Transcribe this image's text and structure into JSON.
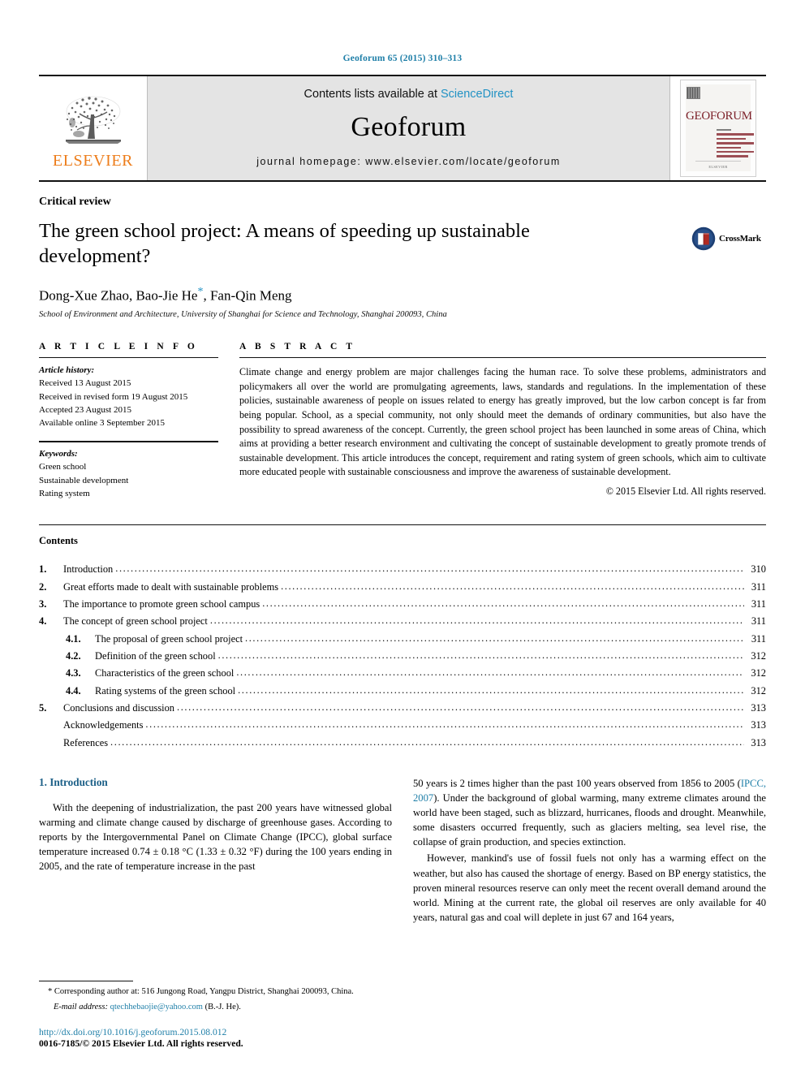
{
  "running_head": "Geoforum 65 (2015) 310–313",
  "masthead": {
    "publisher_name": "ELSEVIER",
    "contents_prefix": "Contents lists available at ",
    "sciencedirect": "ScienceDirect",
    "journal_name": "Geoforum",
    "homepage": "journal homepage: www.elsevier.com/locate/geoforum",
    "cover_title": "GEOFORUM",
    "cover_publisher": "ELSEVIER"
  },
  "article": {
    "doctype": "Critical review",
    "title": "The green school project: A means of speeding up sustainable development?",
    "authors": "Dong-Xue Zhao, Bao-Jie He",
    "authors_tail": ", Fan-Qin Meng",
    "corresponding_marker": "*",
    "affiliation": "School of Environment and Architecture, University of Shanghai for Science and Technology, Shanghai 200093, China",
    "crossmark_label": "CrossMark"
  },
  "info": {
    "heading": "A R T I C L E  I N F O",
    "history_label": "Article history:",
    "history": [
      "Received 13 August 2015",
      "Received in revised form 19 August 2015",
      "Accepted 23 August 2015",
      "Available online 3 September 2015"
    ],
    "keywords_label": "Keywords:",
    "keywords": [
      "Green school",
      "Sustainable development",
      "Rating system"
    ]
  },
  "abstract": {
    "heading": "A B S T R A C T",
    "text": "Climate change and energy problem are major challenges facing the human race. To solve these problems, administrators and policymakers all over the world are promulgating agreements, laws, standards and regulations. In the implementation of these policies, sustainable awareness of people on issues related to energy has greatly improved, but the low carbon concept is far from being popular. School, as a special community, not only should meet the demands of ordinary communities, but also have the possibility to spread awareness of the concept. Currently, the green school project has been launched in some areas of China, which aims at providing a better research environment and cultivating the concept of sustainable development to greatly promote trends of sustainable development. This article introduces the concept, requirement and rating system of green schools, which aim to cultivate more educated people with sustainable consciousness and improve the awareness of sustainable development.",
    "copyright": "© 2015 Elsevier Ltd. All rights reserved."
  },
  "contents": {
    "label": "Contents",
    "entries": [
      {
        "num": "1.",
        "sub": "",
        "label": "Introduction",
        "page": "310",
        "level": 1
      },
      {
        "num": "2.",
        "sub": "",
        "label": "Great efforts made to dealt with sustainable problems",
        "page": "311",
        "level": 1
      },
      {
        "num": "3.",
        "sub": "",
        "label": "The importance to promote green school campus",
        "page": "311",
        "level": 1
      },
      {
        "num": "4.",
        "sub": "",
        "label": "The concept of green school project",
        "page": "311",
        "level": 1
      },
      {
        "num": "",
        "sub": "4.1.",
        "label": "The proposal of green school project",
        "page": "311",
        "level": 2
      },
      {
        "num": "",
        "sub": "4.2.",
        "label": "Definition of the green school",
        "page": "312",
        "level": 2
      },
      {
        "num": "",
        "sub": "4.3.",
        "label": "Characteristics of the green school",
        "page": "312",
        "level": 2
      },
      {
        "num": "",
        "sub": "4.4.",
        "label": "Rating systems of the green school",
        "page": "312",
        "level": 2
      },
      {
        "num": "5.",
        "sub": "",
        "label": "Conclusions and discussion",
        "page": "313",
        "level": 1
      },
      {
        "num": "",
        "sub": "",
        "label": "Acknowledgements",
        "page": "313",
        "level": 1
      },
      {
        "num": "",
        "sub": "",
        "label": "References",
        "page": "313",
        "level": 1
      }
    ]
  },
  "body": {
    "section_heading": "1. Introduction",
    "left_p1": "With the deepening of industrialization, the past 200 years have witnessed global warming and climate change caused by discharge of greenhouse gases. According to reports by the Intergovernmental Panel on Climate Change (IPCC), global surface temperature increased 0.74 ± 0.18 °C (1.33 ± 0.32 °F) during the 100 years ending in 2005, and the rate of temperature increase in the past",
    "right_p1_before": "50 years is 2 times higher than the past 100 years observed from 1856 to 2005 (",
    "right_p1_citation": "IPCC, 2007",
    "right_p1_after": "). Under the background of global warming, many extreme climates around the world have been staged, such as blizzard, hurricanes, floods and drought. Meanwhile, some disasters occurred frequently, such as glaciers melting, sea level rise, the collapse of grain production, and species extinction.",
    "right_p2": "However, mankind's use of fossil fuels not only has a warming effect on the weather, but also has caused the shortage of energy. Based on BP energy statistics, the proven mineral resources reserve can only meet the recent overall demand around the world. Mining at the current rate, the global oil reserves are only available for 40 years, natural gas and coal will deplete in just 67 and 164 years,"
  },
  "footnote": {
    "corresponding": "* Corresponding author at: 516 Jungong Road, Yangpu District, Shanghai 200093, China.",
    "email_label": "E-mail address:",
    "email": "qtechhebaojie@yahoo.com",
    "email_owner": "(B.-J. He).",
    "doi": "http://dx.doi.org/10.1016/j.geoforum.2015.08.012",
    "issn": "0016-7185/© 2015 Elsevier Ltd. All rights reserved."
  },
  "colors": {
    "link": "#1f7fa8",
    "sciencedirect": "#2292c4",
    "elsevier_orange": "#ed7d1b",
    "cover_red": "#7c1f28",
    "heading_blue": "#1b5f87"
  }
}
